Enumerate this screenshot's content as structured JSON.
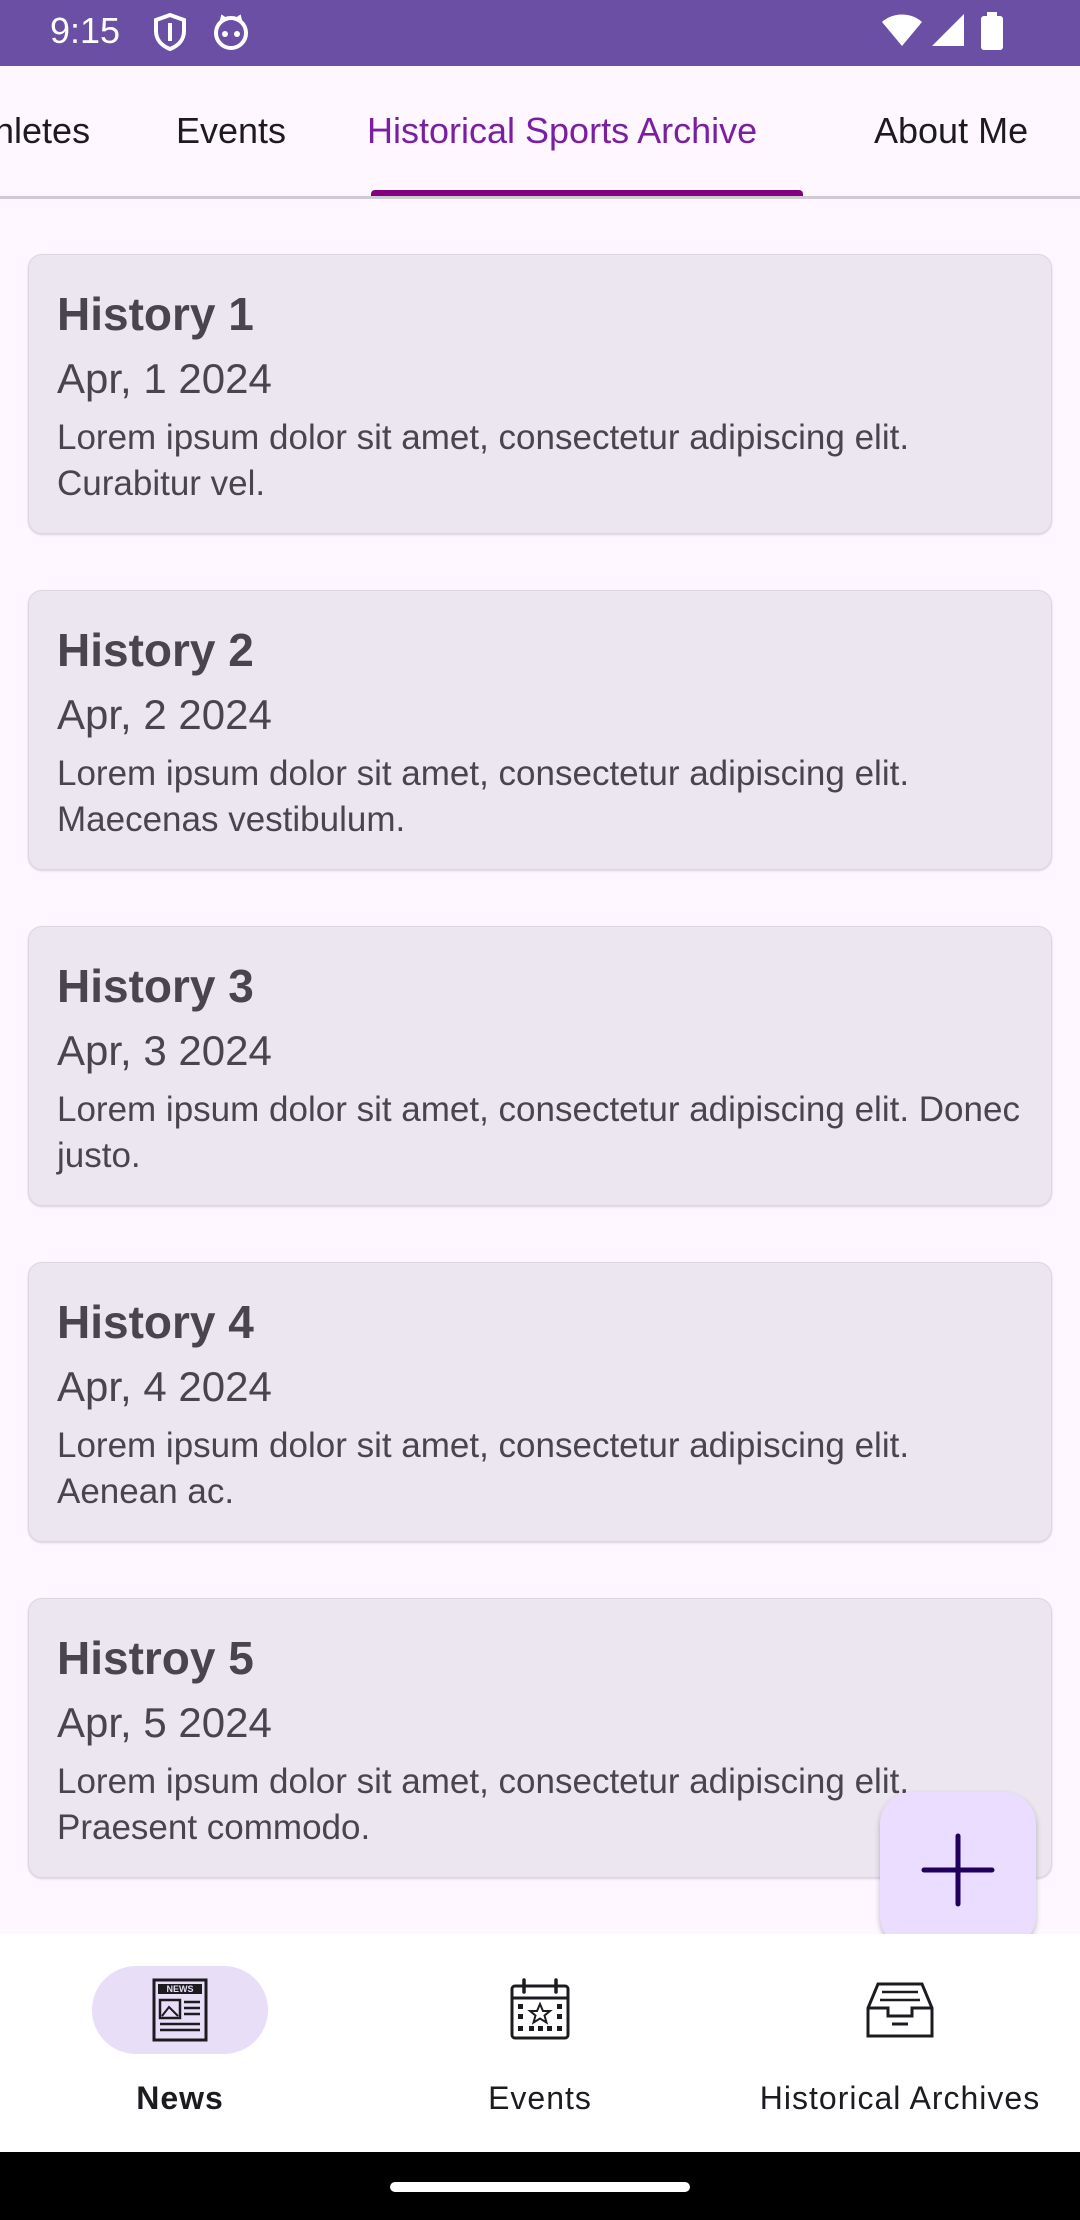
{
  "status_bar": {
    "time": "9:15",
    "left_icons": [
      "shield-icon",
      "cat-face-icon"
    ],
    "right_icons": [
      "wifi-icon",
      "signal-icon",
      "battery-icon"
    ]
  },
  "tabs": [
    {
      "label": "Athletes"
    },
    {
      "label": "Events"
    },
    {
      "label": "Historical Sports Archive",
      "active": true
    },
    {
      "label": "About Me"
    }
  ],
  "cards": [
    {
      "title": "History 1",
      "date": "Apr, 1 2024",
      "desc": "Lorem ipsum dolor sit amet, consectetur adipiscing elit. Curabitur vel."
    },
    {
      "title": "History 2",
      "date": "Apr, 2 2024",
      "desc": "Lorem ipsum dolor sit amet, consectetur adipiscing elit. Maecenas vestibulum."
    },
    {
      "title": "History 3",
      "date": "Apr, 3 2024",
      "desc": "Lorem ipsum dolor sit amet, consectetur adipiscing elit. Donec justo."
    },
    {
      "title": "History 4",
      "date": "Apr, 4 2024",
      "desc": "Lorem ipsum dolor sit amet, consectetur adipiscing elit. Aenean ac."
    },
    {
      "title": "Histroy 5",
      "date": "Apr, 5 2024",
      "desc": "Lorem ipsum dolor sit amet, consectetur adipiscing elit. Praesent commodo."
    }
  ],
  "fab": {
    "icon": "plus-icon"
  },
  "bottom_nav": {
    "items": [
      {
        "label": "News",
        "icon": "newspaper-icon",
        "selected": true
      },
      {
        "label": "Events",
        "icon": "calendar-icon"
      },
      {
        "label": "Historical Archives",
        "icon": "archive-box-icon"
      }
    ]
  },
  "colors": {
    "status_bar": "#6A4FA4",
    "accent": "#800080",
    "card": "#ECE6F0",
    "fab": "#EADDFF",
    "nav_pill": "#E8DEF8"
  }
}
